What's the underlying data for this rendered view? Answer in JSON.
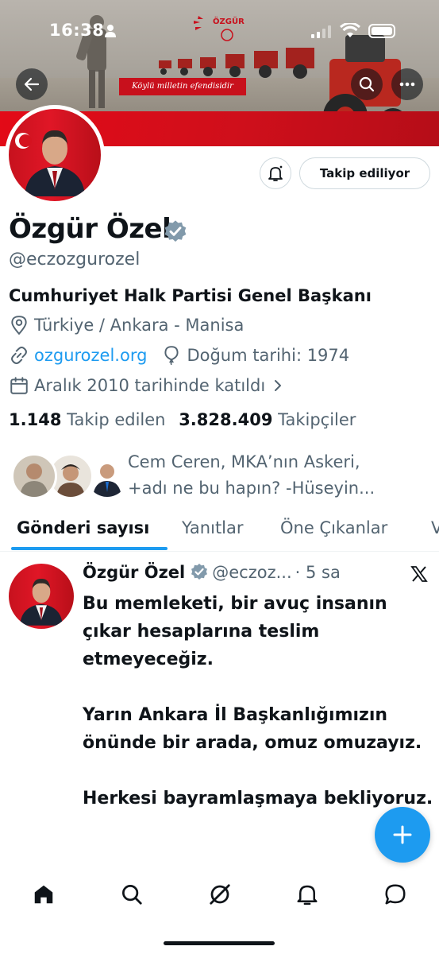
{
  "status_bar": {
    "time": "16:38"
  },
  "banner": {
    "slogan": "Köylü milletin efendisidir",
    "brand": "ÖZGÜR"
  },
  "profile": {
    "name": "Özgür Özel",
    "handle": "@eczozgurozel",
    "bio": "Cumhuriyet Halk Partisi Genel Başkanı",
    "location": "Türkiye / Ankara - Manisa",
    "website": "ozgurozel.org",
    "birthday": "Doğum tarihi: 1974",
    "joined": "Aralık 2010 tarihinde katıldı",
    "following_count": "1.148",
    "following_label": "Takip edilen",
    "followers_count": "3.828.409",
    "followers_label": "Takipçiler",
    "followed_by_line1": "Cem Ceren, MKA’nın Askeri,",
    "followed_by_line2": "+adı ne bu hapın? -Hüseyin..."
  },
  "actions": {
    "following_button": "Takip ediliyor"
  },
  "tabs": [
    {
      "label": "Gönderi sayısı",
      "active": true
    },
    {
      "label": "Yanıtlar",
      "active": false
    },
    {
      "label": "Öne Çıkanlar",
      "active": false
    },
    {
      "label": "V",
      "active": false
    }
  ],
  "post": {
    "author": "Özgür Özel",
    "handle": "@eczoz...",
    "time": "· 5 sa",
    "paragraphs": [
      "Bu memleketi, bir avuç insanın çıkar hesaplarına teslim etmeyeceğiz.",
      "Yarın Ankara İl Başkanlığımızın önünde bir arada, omuz omuzayız.",
      "Herkesi bayramlaşmaya bekliyoruz."
    ]
  },
  "colors": {
    "accent": "#1d9bf0",
    "text": "#0f1419",
    "muted": "#536471",
    "banner_red": "#e30a17",
    "verified": "#829aab"
  },
  "icons": [
    "back-arrow-icon",
    "search-icon",
    "more-icon",
    "bell-icon",
    "verified-icon",
    "location-icon",
    "link-icon",
    "balloon-icon",
    "calendar-icon",
    "chevron-right-icon",
    "x-logo-icon",
    "plus-icon",
    "home-icon",
    "explore-icon",
    "grok-icon",
    "notifications-icon",
    "messages-icon"
  ]
}
